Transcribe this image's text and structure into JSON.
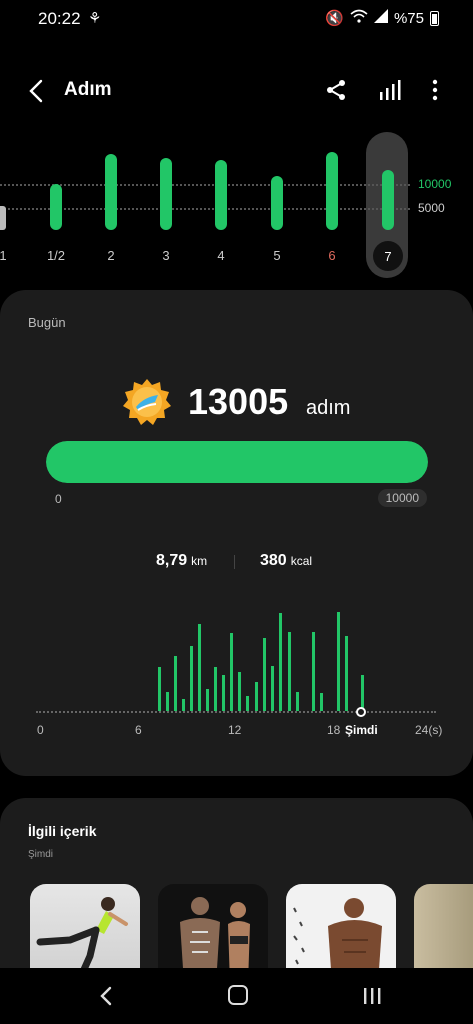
{
  "status": {
    "time": "20:22",
    "battery": "%75"
  },
  "header": {
    "title": "Adım"
  },
  "week": {
    "labels": [
      "1",
      "1/2",
      "2",
      "3",
      "4",
      "5",
      "6",
      "7"
    ],
    "goal_labels": [
      "10000",
      "5000"
    ],
    "selected": "7"
  },
  "today": {
    "title": "Bugün",
    "steps": "13005",
    "unit": "adım",
    "progress_fraction": 1.0,
    "prog_min": "0",
    "prog_goal": "10000",
    "distance": "8,79",
    "distance_unit": "km",
    "calories": "380",
    "calories_unit": "kcal",
    "day_labels": [
      "0",
      "6",
      "12",
      "18",
      "24(s)"
    ],
    "now_label": "Şimdi"
  },
  "related": {
    "title": "İlgili içerik",
    "subtitle": "Şimdi"
  },
  "colors": {
    "accent": "#22c667",
    "card": "#1c1c1c",
    "weekend": "#e06b5e"
  }
}
